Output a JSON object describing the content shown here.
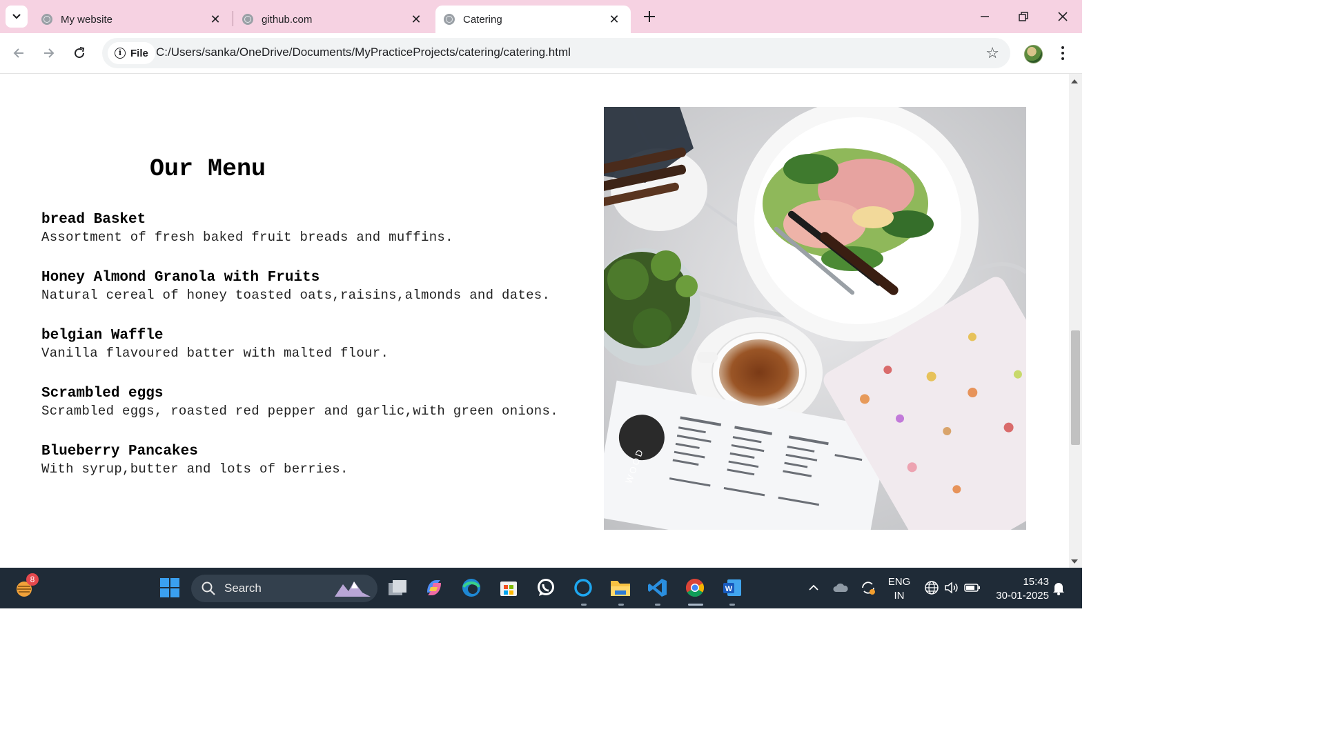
{
  "browser": {
    "tabs": [
      {
        "title": "My website",
        "active": false
      },
      {
        "title": "github.com",
        "active": false
      },
      {
        "title": "Catering",
        "active": true
      }
    ],
    "new_tab_icon": "plus-icon",
    "address": {
      "chip_label": "File",
      "url": "C:/Users/sanka/OneDrive/Documents/MyPracticeProjects/catering/catering.html"
    },
    "colors": {
      "tabstrip": "#f6d2e2",
      "omnibox": "#f1f3f4"
    }
  },
  "page": {
    "title": "Our Menu",
    "items": [
      {
        "name": "bread Basket",
        "description": "Assortment of fresh baked fruit breads and muffins."
      },
      {
        "name": "Honey Almond Granola with Fruits",
        "description": "Natural cereal of honey toasted oats,raisins,almonds and dates."
      },
      {
        "name": "belgian Waffle",
        "description": "Vanilla flavoured batter with malted flour."
      },
      {
        "name": "Scrambled eggs",
        "description": "Scrambled eggs, roasted red pepper and garlic,with green onions."
      },
      {
        "name": "Blueberry Pancakes",
        "description": "With syrup,butter and lots of berries."
      }
    ],
    "photo": {
      "subject": "table-with-salad-coffee-menu-laptop",
      "menu_card_logo_text": "WOOD"
    }
  },
  "taskbar": {
    "weather_badge": "8",
    "search_label": "Search",
    "pinned_apps": [
      "windows-start-icon",
      "search-icon",
      "task-view-icon",
      "copilot-icon",
      "edge-icon",
      "store-icon",
      "whatsapp-icon",
      "cortana-icon",
      "file-explorer-icon",
      "vscode-icon",
      "chrome-icon",
      "word-icon"
    ],
    "language_line1": "ENG",
    "language_line2": "IN",
    "time": "15:43",
    "date": "30-01-2025"
  }
}
